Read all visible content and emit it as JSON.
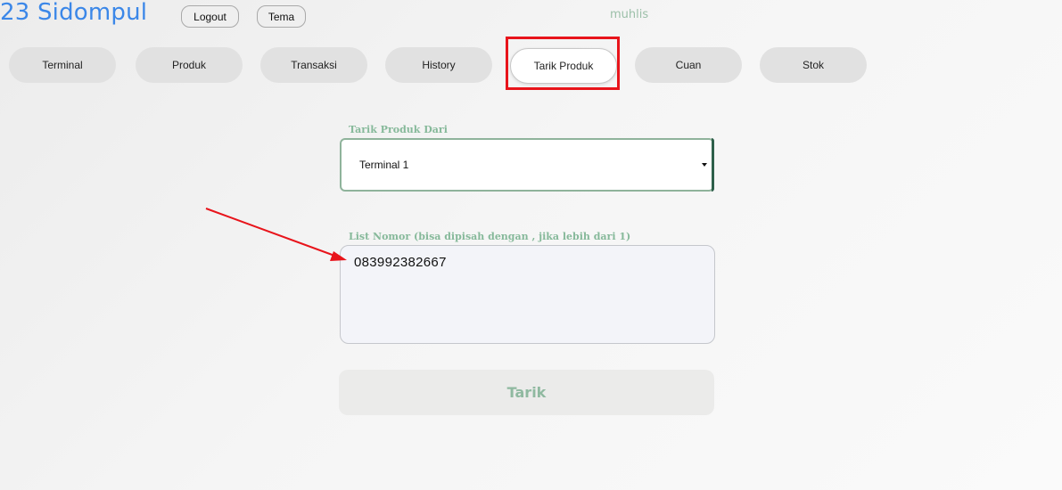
{
  "header": {
    "brand": "23 Sidompul",
    "logout_label": "Logout",
    "theme_label": "Tema",
    "username": "muhlis"
  },
  "nav": {
    "tabs": [
      {
        "label": "Terminal"
      },
      {
        "label": "Produk"
      },
      {
        "label": "Transaksi"
      },
      {
        "label": "History"
      },
      {
        "label": "Tarik Produk",
        "active": true
      },
      {
        "label": "Cuan"
      },
      {
        "label": "Stok"
      }
    ]
  },
  "form": {
    "source_label": "Tarik Produk Dari",
    "source_value": "Terminal 1",
    "numbers_label": "List Nomor (bisa dipisah dengan , jika lebih dari 1)",
    "numbers_value": "083992382667",
    "submit_label": "Tarik"
  },
  "annotations": {
    "highlight_color": "#e8141b",
    "arrow_color": "#e8141b"
  },
  "colors": {
    "brand": "#3b87e8",
    "accent_green": "#86b99a"
  }
}
